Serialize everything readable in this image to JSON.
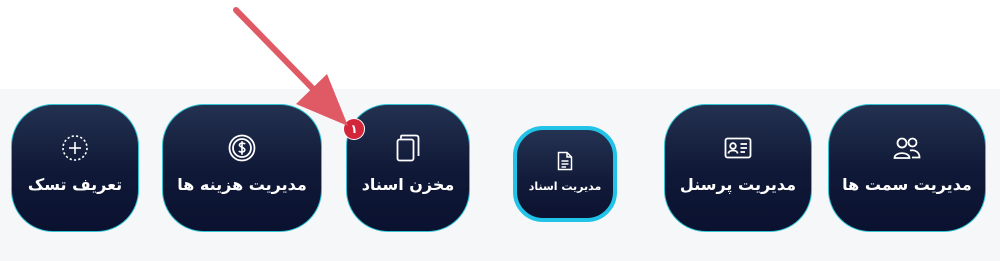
{
  "tiles": [
    {
      "label": "مدیریت سمت ها",
      "icon": "users-icon"
    },
    {
      "label": "مدیریت پرسنل",
      "icon": "id-card-icon"
    },
    {
      "label": "مدیریت اسناد",
      "icon": "document-icon"
    },
    {
      "label": "مخزن اسناد",
      "icon": "files-icon"
    },
    {
      "label": "مدیریت هزینه ها",
      "icon": "dollar-coin-icon"
    },
    {
      "label": "تعریف تسک",
      "icon": "plus-circle-icon"
    }
  ],
  "badge": {
    "count": "۱"
  },
  "colors": {
    "tile": "#0f1836",
    "border": "#2ec4d6",
    "badge": "#d4263a",
    "arrow": "#e05a66"
  }
}
